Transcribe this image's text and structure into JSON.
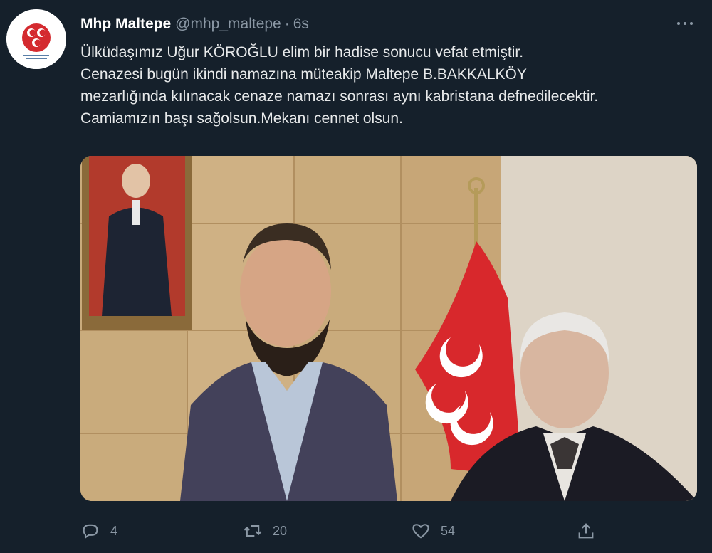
{
  "tweet": {
    "author": {
      "name": "Mhp Maltepe",
      "handle": "@mhp_maltepe",
      "time": "6s"
    },
    "text_lines": [
      "Ülküdaşımız Uğur KÖROĞLU elim bir hadise sonucu vefat etmiştir.",
      "Cenazesi bugün ikindi namazına müteakip Maltepe B.BAKKALKÖY",
      "mezarlığında kılınacak cenaze namazı sonrası aynı kabristana defnedilecektir.",
      "Camiamızın başı sağolsun.Mekanı cennet olsun."
    ],
    "media": {
      "description_icon": "photo"
    },
    "actions": {
      "reply": {
        "icon": "reply-icon",
        "count": "4"
      },
      "retweet": {
        "icon": "retweet-icon",
        "count": "20"
      },
      "like": {
        "icon": "heart-icon",
        "count": "54"
      },
      "share": {
        "icon": "share-icon"
      }
    }
  },
  "colors": {
    "background": "#15202b",
    "text": "#e7e9ea",
    "secondary": "#8b98a5",
    "flag_red": "#d8282c"
  }
}
